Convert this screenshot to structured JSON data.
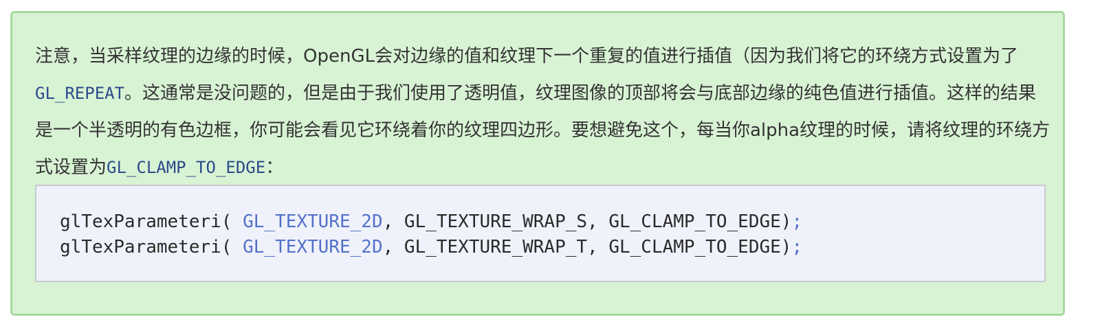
{
  "note": {
    "text_1": "注意，当采样纹理的边缘的时候，OpenGL会对边缘的值和纹理下一个重复的值进行插值（因为我们将它的环绕方式设置为了",
    "code_1": "GL_REPEAT",
    "text_2": "。这通常是没问题的，但是由于我们使用了透明值，纹理图像的顶部将会与底部边缘的纯色值进行插值。这样的结果是一个半透明的有色边框，你可能会看见它环绕着你的纹理四边形。要想避免这个，每当你alpha纹理的时候，请将纹理的环绕方式设置为",
    "code_2": "GL_CLAMP_TO_EDGE",
    "text_3": "："
  },
  "code_block": {
    "lines": [
      {
        "func": "glTexParameteri(",
        "target": "GL_TEXTURE_2D",
        "args": ", GL_TEXTURE_WRAP_S, GL_CLAMP_TO_EDGE)",
        "end": ";"
      },
      {
        "func": "glTexParameteri(",
        "target": "GL_TEXTURE_2D",
        "args": ", GL_TEXTURE_WRAP_T, GL_CLAMP_TO_EDGE)",
        "end": ";"
      }
    ]
  },
  "colors": {
    "box_background": "#d8f3d4",
    "box_border": "#a6d99f",
    "code_background": "#eff2fb",
    "code_keyword": "#5470c9",
    "inline_code": "#2c4a8a"
  }
}
